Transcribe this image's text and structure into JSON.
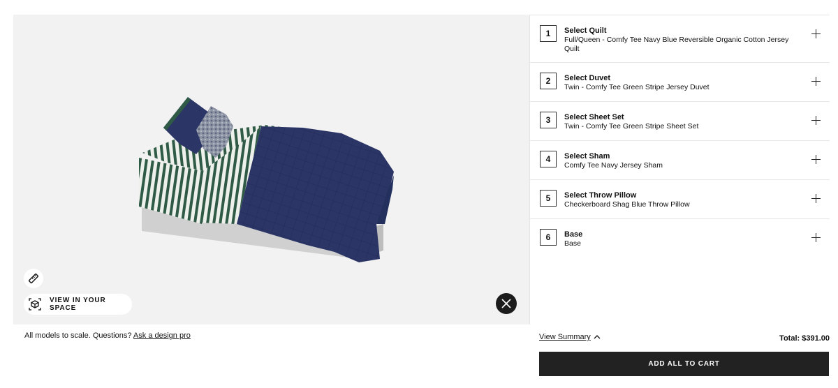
{
  "viewer": {
    "view_in_space_label": "VIEW IN YOUR SPACE",
    "icons": {
      "measure": "ruler-icon",
      "ar": "ar-cube-icon",
      "close": "close-icon"
    }
  },
  "caption": {
    "text": "All models to scale. Questions?",
    "link": "Ask a design pro"
  },
  "steps": [
    {
      "number": "1",
      "title": "Select Quilt",
      "value": "Full/Queen - Comfy Tee Navy Blue Reversible Organic Cotton Jersey Quilt"
    },
    {
      "number": "2",
      "title": "Select Duvet",
      "value": "Twin - Comfy Tee Green Stripe Jersey Duvet"
    },
    {
      "number": "3",
      "title": "Select Sheet Set",
      "value": "Twin - Comfy Tee Green Stripe Sheet Set"
    },
    {
      "number": "4",
      "title": "Select Sham",
      "value": "Comfy Tee Navy Jersey Sham"
    },
    {
      "number": "5",
      "title": "Select Throw Pillow",
      "value": "Checkerboard Shag Blue Throw Pillow"
    },
    {
      "number": "6",
      "title": "Base",
      "value": "Base"
    }
  ],
  "footer": {
    "summary_label": "View Summary",
    "total": "Total: $391.00",
    "cta": "ADD ALL TO CART"
  },
  "colors": {
    "quilt_navy": "#2b3566",
    "stripe_green": "#2f5a46",
    "base_gray": "#cfcfcf",
    "button_dark": "#222222"
  }
}
